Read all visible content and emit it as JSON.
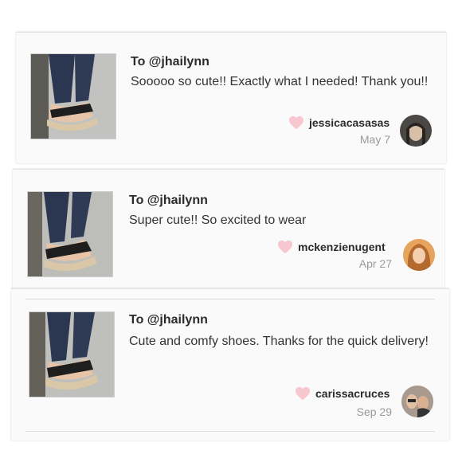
{
  "comments": [
    {
      "to": "To @jhailynn",
      "message": "Sooooo so cute!! Exactly what I needed! Thank you!!",
      "username": "jessicacasasas",
      "date": "May 7"
    },
    {
      "to": "To @jhailynn",
      "message": "Super cute!! So excited to wear",
      "username": "mckenzienugent",
      "date": "Apr 27"
    },
    {
      "to": "To @jhailynn",
      "message": "Cute and comfy shoes. Thanks for the quick delivery!",
      "username": "carissacruces",
      "date": "Sep 29"
    }
  ],
  "colors": {
    "heart": "#f7c6cf",
    "date": "#9a9a9a",
    "card_bg": "#fafafa"
  },
  "icons": {
    "heart": "heart-icon"
  }
}
